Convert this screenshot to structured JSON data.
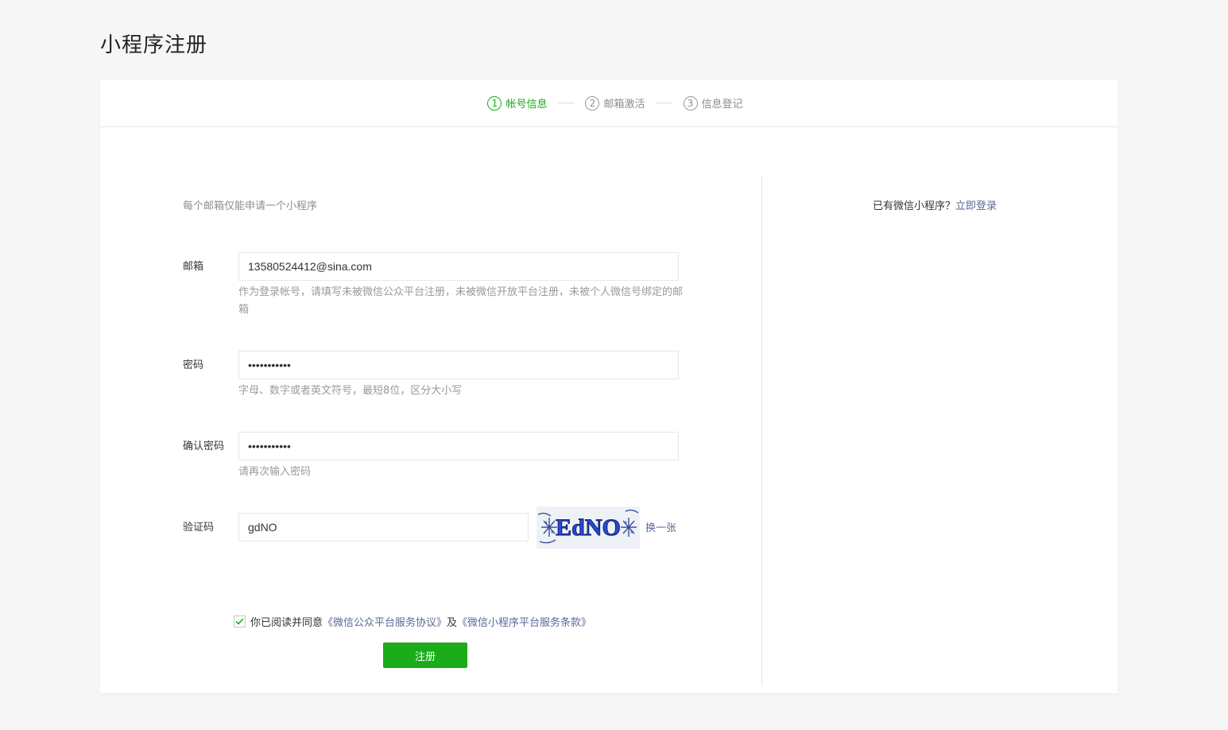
{
  "page": {
    "title": "小程序注册"
  },
  "steps": [
    {
      "num": "1",
      "label": "帐号信息",
      "active": true
    },
    {
      "num": "2",
      "label": "邮箱激活",
      "active": false
    },
    {
      "num": "3",
      "label": "信息登记",
      "active": false
    }
  ],
  "form": {
    "intro": "每个邮箱仅能申请一个小程序",
    "email": {
      "label": "邮箱",
      "value": "13580524412@sina.com",
      "hint": "作为登录帐号，请填写未被微信公众平台注册，未被微信开放平台注册，未被个人微信号绑定的邮箱"
    },
    "password": {
      "label": "密码",
      "value": "•••••••••••",
      "hint": "字母、数字或者英文符号，最短8位，区分大小写"
    },
    "confirm": {
      "label": "确认密码",
      "value": "•••••••••••",
      "hint": "请再次输入密码"
    },
    "captcha": {
      "label": "验证码",
      "value": "gdNO",
      "image_text": "EdNO",
      "swap_label": "换一张"
    },
    "agreement": {
      "prefix": "你已阅读并同意",
      "link1": "《微信公众平台服务协议》",
      "mid": "及",
      "link2": "《微信小程序平台服务条款》",
      "checked": true
    },
    "submit_label": "注册"
  },
  "side": {
    "question": "已有微信小程序？",
    "login_link": "立即登录"
  },
  "colors": {
    "accent": "#1aad19",
    "link": "#576b95"
  }
}
